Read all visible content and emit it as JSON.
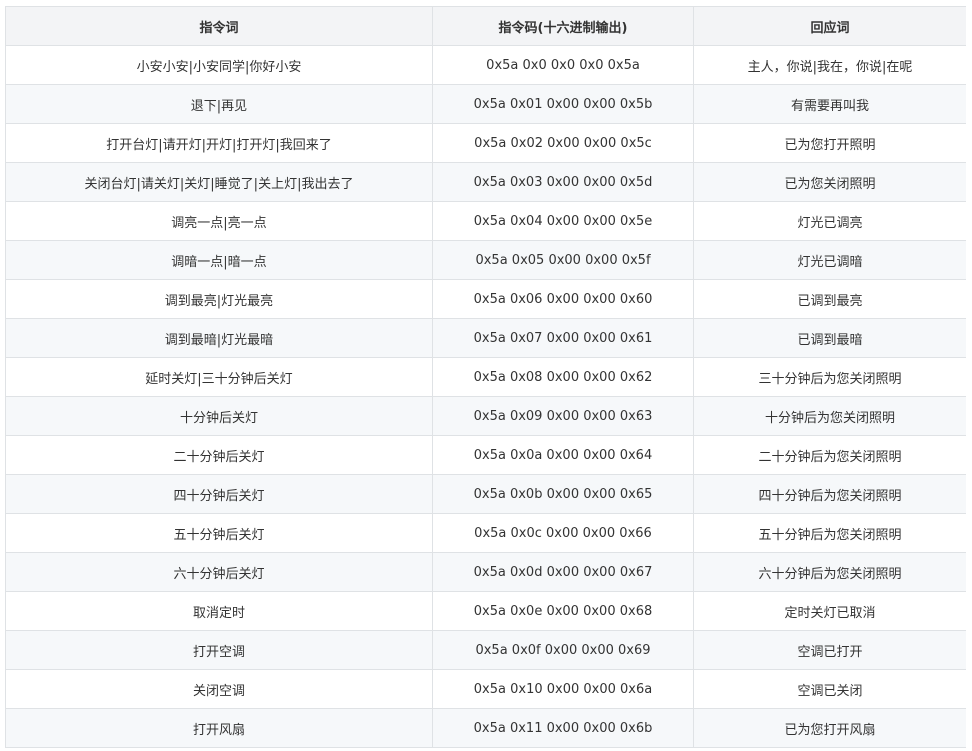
{
  "table": {
    "headers": [
      "指令词",
      "指令码(十六进制输出)",
      "回应词"
    ],
    "rows": [
      [
        "小安小安|小安同学|你好小安",
        "0x5a 0x0 0x0 0x0 0x5a",
        "主人，你说|我在，你说|在呢"
      ],
      [
        "退下|再见",
        "0x5a 0x01 0x00 0x00 0x5b",
        "有需要再叫我"
      ],
      [
        "打开台灯|请开灯|开灯|打开灯|我回来了",
        "0x5a 0x02 0x00 0x00 0x5c",
        "已为您打开照明"
      ],
      [
        "关闭台灯|请关灯|关灯|睡觉了|关上灯|我出去了",
        "0x5a 0x03 0x00 0x00 0x5d",
        "已为您关闭照明"
      ],
      [
        "调亮一点|亮一点",
        "0x5a 0x04 0x00 0x00 0x5e",
        "灯光已调亮"
      ],
      [
        "调暗一点|暗一点",
        "0x5a 0x05 0x00 0x00 0x5f",
        "灯光已调暗"
      ],
      [
        "调到最亮|灯光最亮",
        "0x5a 0x06 0x00 0x00 0x60",
        "已调到最亮"
      ],
      [
        "调到最暗|灯光最暗",
        "0x5a 0x07 0x00 0x00 0x61",
        "已调到最暗"
      ],
      [
        "延时关灯|三十分钟后关灯",
        "0x5a 0x08 0x00 0x00 0x62",
        "三十分钟后为您关闭照明"
      ],
      [
        "十分钟后关灯",
        "0x5a 0x09 0x00 0x00 0x63",
        "十分钟后为您关闭照明"
      ],
      [
        "二十分钟后关灯",
        "0x5a 0x0a 0x00 0x00 0x64",
        "二十分钟后为您关闭照明"
      ],
      [
        "四十分钟后关灯",
        "0x5a 0x0b 0x00 0x00 0x65",
        "四十分钟后为您关闭照明"
      ],
      [
        "五十分钟后关灯",
        "0x5a 0x0c 0x00 0x00 0x66",
        "五十分钟后为您关闭照明"
      ],
      [
        "六十分钟后关灯",
        "0x5a 0x0d 0x00 0x00 0x67",
        "六十分钟后为您关闭照明"
      ],
      [
        "取消定时",
        "0x5a 0x0e 0x00 0x00 0x68",
        "定时关灯已取消"
      ],
      [
        "打开空调",
        "0x5a 0x0f 0x00 0x00 0x69",
        "空调已打开"
      ],
      [
        "关闭空调",
        "0x5a 0x10 0x00 0x00 0x6a",
        "空调已关闭"
      ],
      [
        "打开风扇",
        "0x5a 0x11 0x00 0x00 0x6b",
        "已为您打开风扇"
      ]
    ]
  }
}
